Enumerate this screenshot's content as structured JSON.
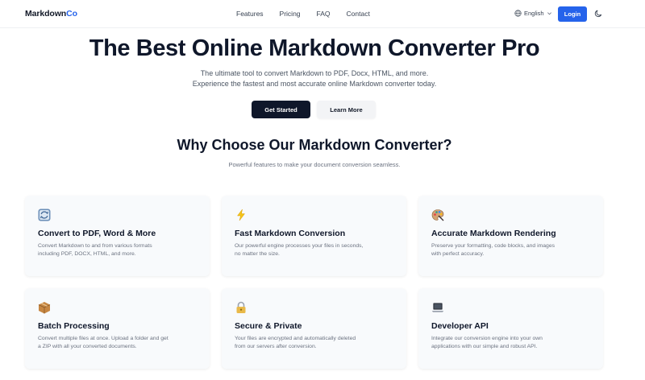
{
  "nav": {
    "logo_part1": "Markdown",
    "logo_part2": "Co",
    "links": [
      "Features",
      "Pricing",
      "FAQ",
      "Contact"
    ],
    "language": "English",
    "login_label": "Login"
  },
  "hero": {
    "title": "The Best Online Markdown Converter Pro",
    "subtitle_line1": "The ultimate tool to convert Markdown to PDF, Docx, HTML, and more.",
    "subtitle_line2": "Experience the fastest and most accurate online Markdown converter today.",
    "primary_button": "Get Started",
    "secondary_button": "Learn More"
  },
  "features": {
    "title": "Why Choose Our Markdown Converter?",
    "subtitle": "Powerful features to make your document conversion seamless.",
    "cards": [
      {
        "icon": "convert-icon",
        "title": "Convert to PDF, Word & More",
        "desc_line1": "Convert Markdown to and from various formats",
        "desc_line2": "including PDF, DOCX, HTML, and more."
      },
      {
        "icon": "lightning-icon",
        "title": "Fast Markdown Conversion",
        "desc_line1": "Our powerful engine processes your files in seconds,",
        "desc_line2": "no matter the size."
      },
      {
        "icon": "palette-icon",
        "title": "Accurate Markdown Rendering",
        "desc_line1": "Preserve your formatting, code blocks, and images",
        "desc_line2": "with perfect accuracy."
      },
      {
        "icon": "package-icon",
        "title": "Batch Processing",
        "desc_line1": "Convert multiple files at once. Upload a folder and get",
        "desc_line2": "a ZIP with all your converted documents."
      },
      {
        "icon": "lock-icon",
        "title": "Secure & Private",
        "desc_line1": "Your files are encrypted and automatically deleted",
        "desc_line2": "from our servers after conversion."
      },
      {
        "icon": "laptop-icon",
        "title": "Developer API",
        "desc_line1": "Integrate our conversion engine into your own",
        "desc_line2": "applications with our simple and robust API."
      }
    ]
  },
  "colors": {
    "accent": "#2563eb",
    "dark": "#0f172a",
    "card_bg": "#f8fafc"
  }
}
